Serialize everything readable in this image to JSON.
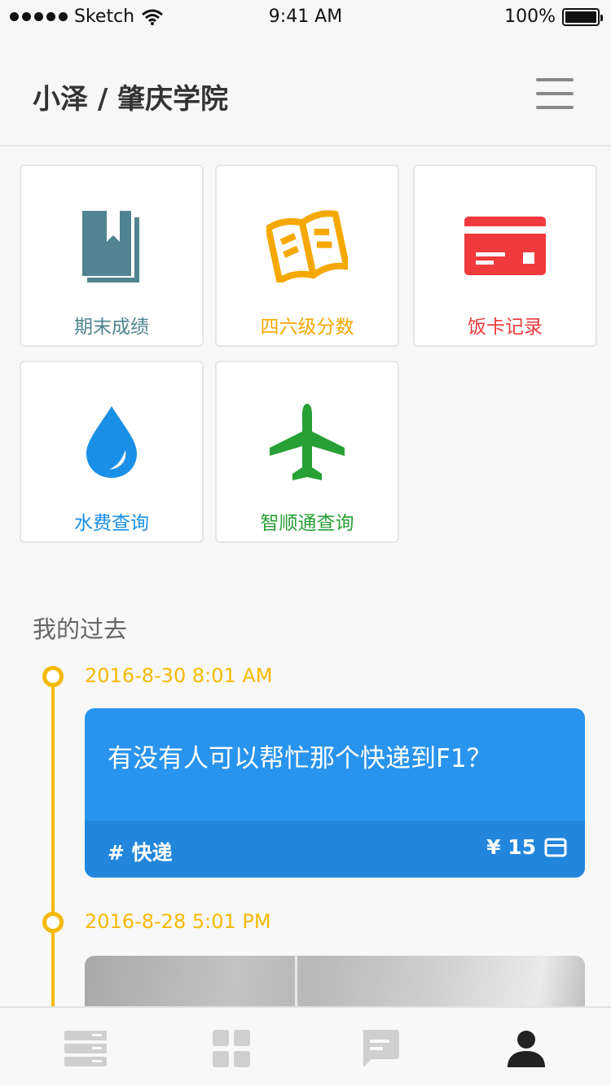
{
  "status_bar": {
    "carrier": "Sketch",
    "time": "9:41 AM",
    "battery": "100%"
  },
  "header": {
    "title": "小泽 / 肇庆学院"
  },
  "tiles": [
    {
      "label": "期末成绩",
      "icon": "book-icon",
      "color": "#4f8490"
    },
    {
      "label": "四六级分数",
      "icon": "open-book-icon",
      "color": "#f5a800"
    },
    {
      "label": "饭卡记录",
      "icon": "credit-card-icon",
      "color": "#f03a3e"
    },
    {
      "label": "水费查询",
      "icon": "water-drop-icon",
      "color": "#1a8fe6"
    },
    {
      "label": "智顺通查询",
      "icon": "airplane-icon",
      "color": "#27a035"
    }
  ],
  "timeline": {
    "title": "我的过去",
    "entries": [
      {
        "date": "2016-8-30 8:01 AM",
        "text": "有没有人可以帮忙那个快递到F1？",
        "tag": "# 快递",
        "price": "¥ 15"
      },
      {
        "date": "2016-8-28 5:01 PM"
      }
    ]
  },
  "tabbar": {
    "icons": [
      "list-icon",
      "grid-icon",
      "message-icon",
      "profile-icon"
    ],
    "active": "profile-icon"
  }
}
